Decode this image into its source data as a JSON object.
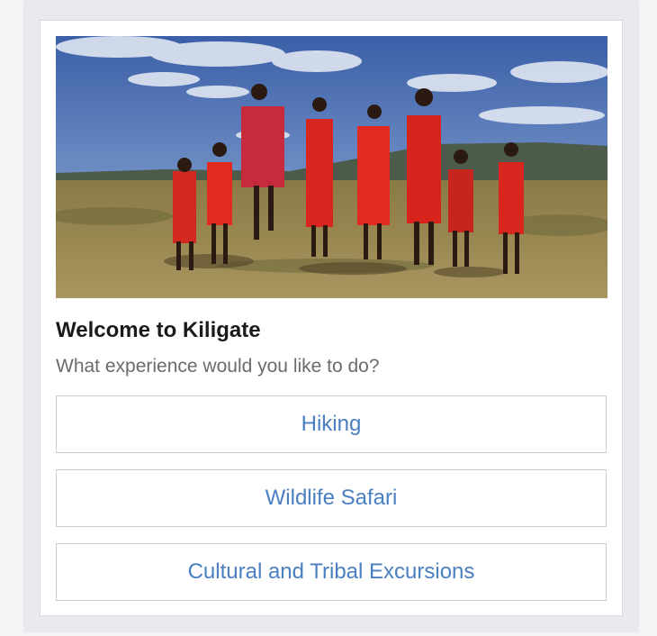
{
  "card": {
    "image": "maasai-dancers-photo",
    "title": "Welcome to Kiligate",
    "subtitle": "What experience would you like to do?"
  },
  "choices": [
    {
      "label": "Hiking"
    },
    {
      "label": "Wildlife Safari"
    },
    {
      "label": "Cultural and Tribal Excursions"
    }
  ],
  "colors": {
    "button_text": "#4a7fc1",
    "button_border": "#c9ccd1",
    "title": "#1b1b1b",
    "subtitle": "#6b6b6b"
  }
}
